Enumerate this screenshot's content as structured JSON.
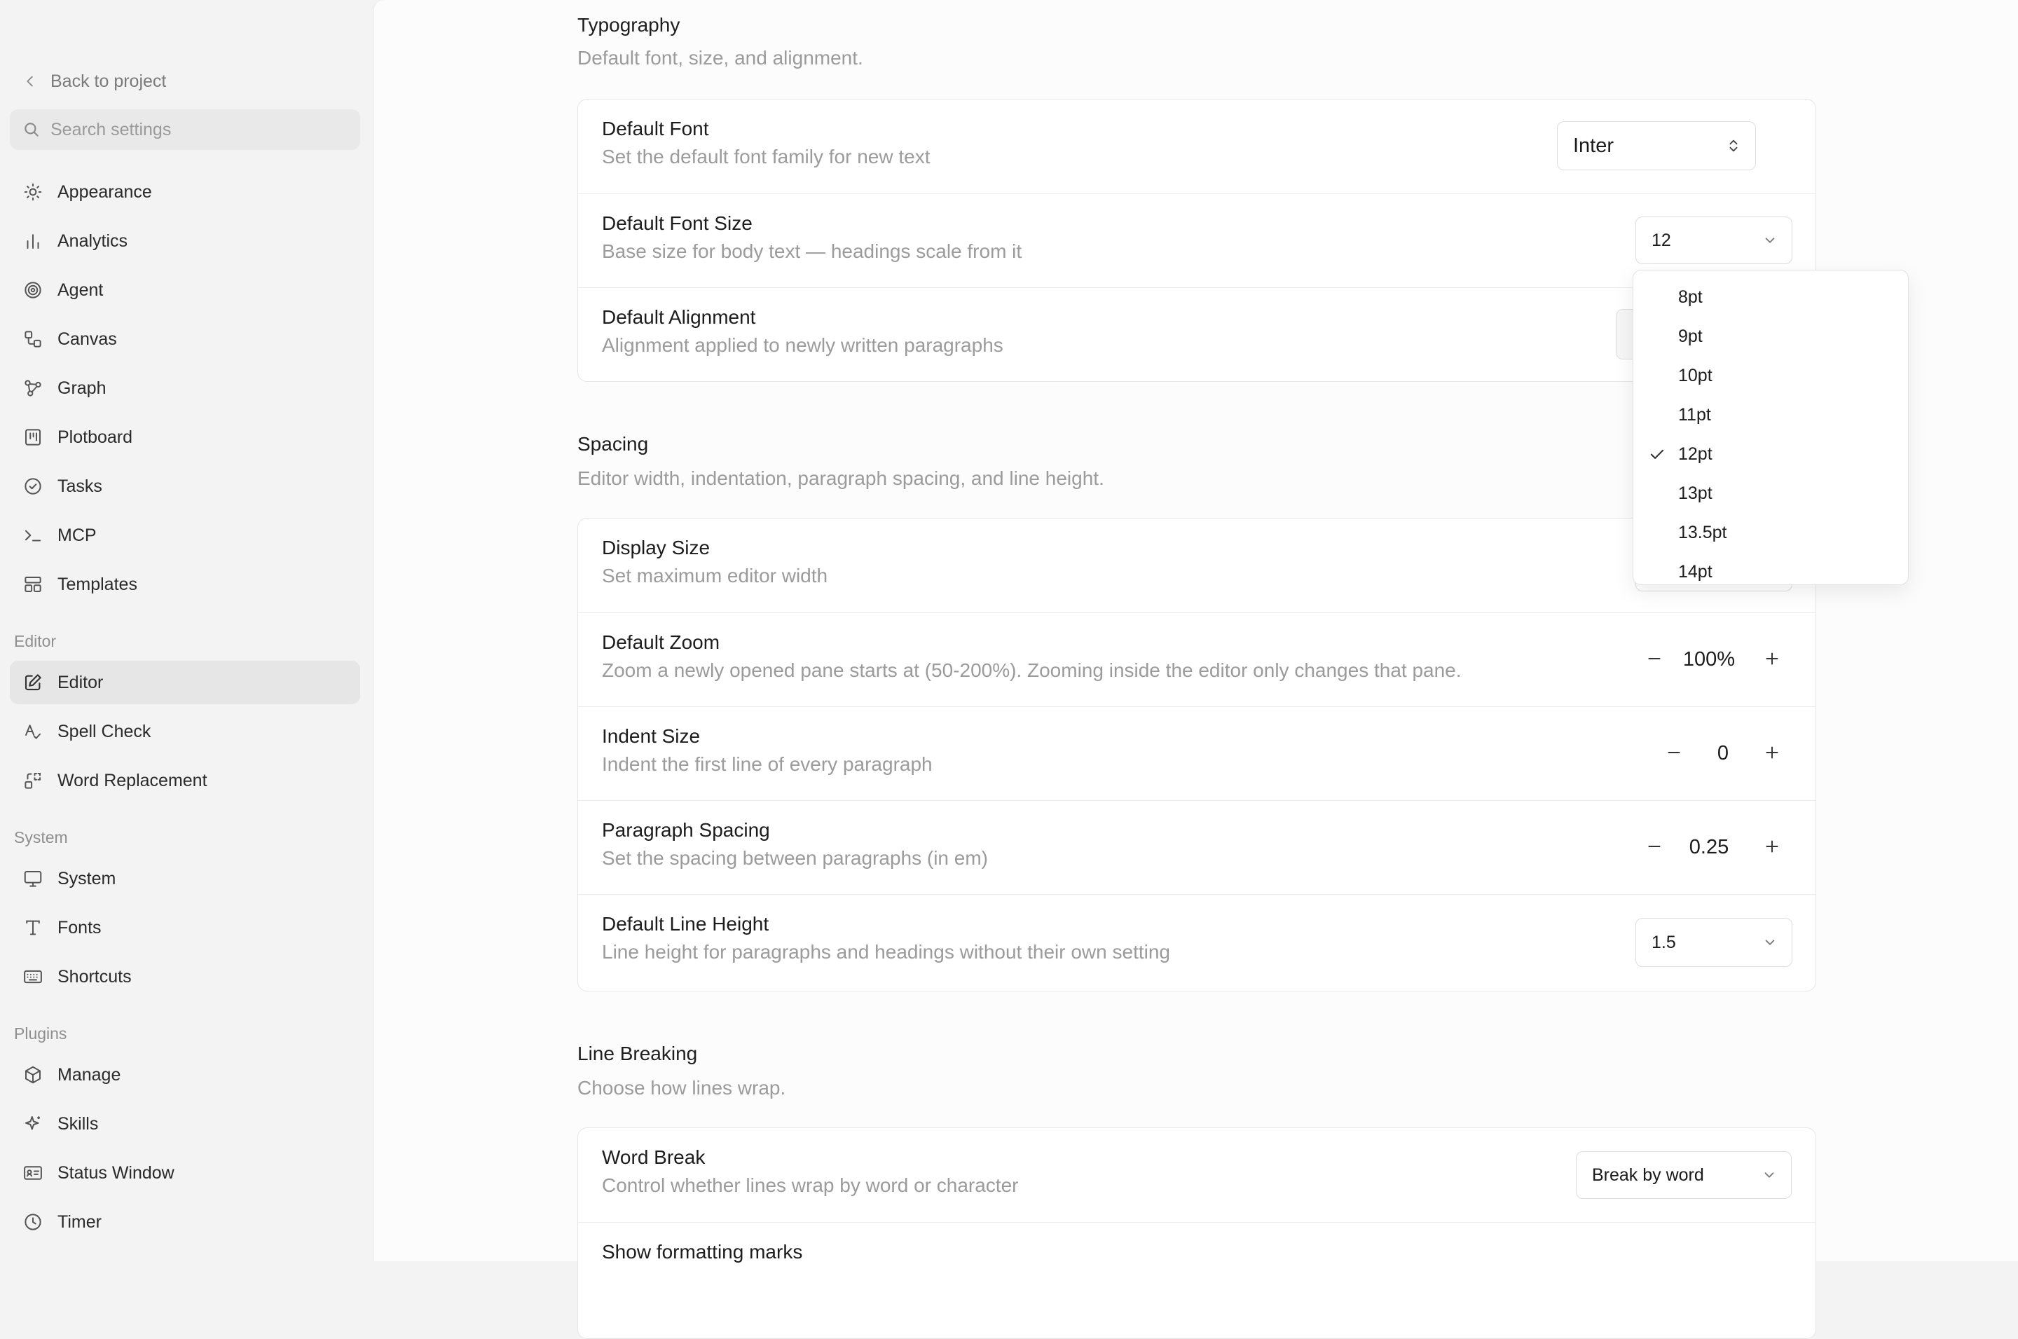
{
  "sidebar": {
    "back_label": "Back to project",
    "search_placeholder": "Search settings",
    "items": [
      {
        "label": "Appearance",
        "icon": "sun-icon"
      },
      {
        "label": "Analytics",
        "icon": "bar-chart-icon"
      },
      {
        "label": "Agent",
        "icon": "spiral-icon"
      },
      {
        "label": "Canvas",
        "icon": "canvas-shapes-icon"
      },
      {
        "label": "Graph",
        "icon": "graph-nodes-icon"
      },
      {
        "label": "Plotboard",
        "icon": "plotboard-icon"
      },
      {
        "label": "Tasks",
        "icon": "check-circle-icon"
      },
      {
        "label": "MCP",
        "icon": "terminal-icon"
      },
      {
        "label": "Templates",
        "icon": "layout-template-icon"
      }
    ],
    "editor_group": {
      "label": "Editor",
      "items": [
        {
          "label": "Editor",
          "icon": "pencil-square-icon",
          "active": true
        },
        {
          "label": "Spell Check",
          "icon": "spell-check-icon"
        },
        {
          "label": "Word Replacement",
          "icon": "word-replace-icon"
        }
      ]
    },
    "system_group": {
      "label": "System",
      "items": [
        {
          "label": "System",
          "icon": "monitor-icon"
        },
        {
          "label": "Fonts",
          "icon": "type-icon"
        },
        {
          "label": "Shortcuts",
          "icon": "keyboard-icon"
        }
      ]
    },
    "plugins_group": {
      "label": "Plugins",
      "items": [
        {
          "label": "Manage",
          "icon": "box-icon"
        },
        {
          "label": "Skills",
          "icon": "sparkle-icon"
        },
        {
          "label": "Status Window",
          "icon": "id-card-icon"
        },
        {
          "label": "Timer",
          "icon": "clock-icon"
        }
      ]
    }
  },
  "typography": {
    "title": "Typography",
    "desc": "Default font, size, and alignment.",
    "rows": {
      "font": {
        "title": "Default Font",
        "desc": "Set the default font family for new text",
        "value": "Inter"
      },
      "size": {
        "title": "Default Font Size",
        "desc": "Base size for body text — headings scale from it",
        "value": "12"
      },
      "align": {
        "title": "Default Alignment",
        "desc": "Alignment applied to newly written paragraphs"
      }
    }
  },
  "spacing": {
    "title": "Spacing",
    "desc": "Editor width, indentation, paragraph spacing, and line height.",
    "rows": {
      "display": {
        "title": "Display Size",
        "desc": "Set maximum editor width"
      },
      "zoom": {
        "title": "Default Zoom",
        "desc": "Zoom a newly opened pane starts at (50-200%). Zooming inside the editor only changes that pane.",
        "value": "100%"
      },
      "indent": {
        "title": "Indent Size",
        "desc": "Indent the first line of every paragraph",
        "value": "0"
      },
      "para": {
        "title": "Paragraph Spacing",
        "desc": "Set the spacing between paragraphs (in em)",
        "value": "0.25"
      },
      "line": {
        "title": "Default Line Height",
        "desc": "Line height for paragraphs and headings without their own setting",
        "value": "1.5"
      }
    }
  },
  "line_breaking": {
    "title": "Line Breaking",
    "desc": "Choose how lines wrap.",
    "rows": {
      "word": {
        "title": "Word Break",
        "desc": "Control whether lines wrap by word or character",
        "value": "Break by word"
      },
      "marks": {
        "title": "Show formatting marks"
      }
    }
  },
  "font_size_dropdown": {
    "options": [
      "8pt",
      "9pt",
      "10pt",
      "11pt",
      "12pt",
      "13pt",
      "13.5pt",
      "14pt"
    ],
    "selected": "12pt"
  },
  "colors": {
    "sidebar_bg": "#f3f3f3",
    "main_bg": "#fcfcfc",
    "active_item_bg": "#e6e6e6",
    "muted_text": "#9b9b9b"
  }
}
